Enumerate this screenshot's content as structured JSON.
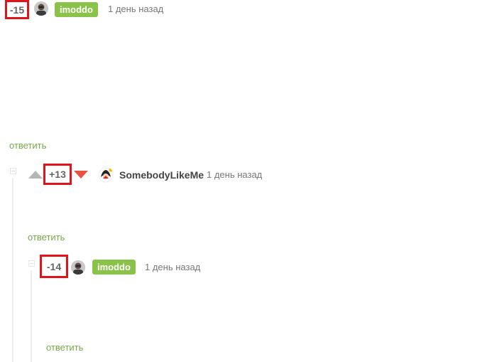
{
  "comments": [
    {
      "rating": "-15",
      "author": "imoddo",
      "time": "1 день назад",
      "reply_label": "ответить"
    },
    {
      "rating": "+13",
      "author": "SomebodyLikeMe",
      "time": "1 день назад",
      "reply_label": "ответить"
    },
    {
      "rating": "-14",
      "author": "imoddo",
      "time": "1 день назад",
      "reply_label": "ответить"
    }
  ],
  "colors": {
    "highlight_border": "#e0141b",
    "author_badge": "#8bc34a",
    "reply_link": "#74a94a",
    "upvote_arrow": "#b5b5b5",
    "downvote_arrow": "#e8533f"
  },
  "icons": {
    "upvote": "triangle-up",
    "downvote": "triangle-down",
    "collapse": "minus-square"
  }
}
